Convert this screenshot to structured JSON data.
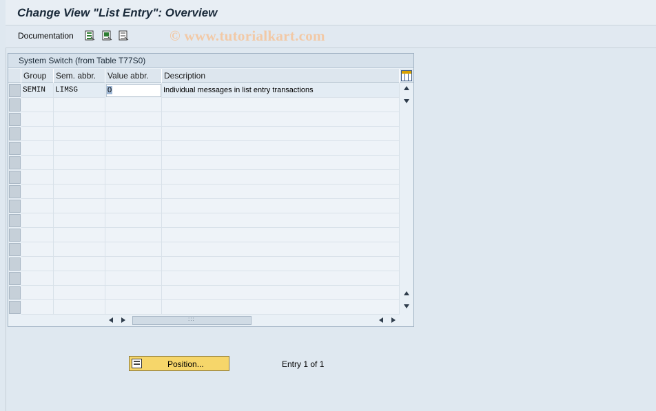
{
  "window": {
    "title": "Change View \"List Entry\": Overview"
  },
  "toolbar": {
    "documentation_label": "Documentation",
    "icons": [
      "select-all-icon",
      "select-block-icon",
      "deselect-all-icon"
    ],
    "watermark": "© www.tutorialkart.com"
  },
  "table": {
    "caption": "System Switch (from Table T77S0)",
    "columns": [
      "Group",
      "Sem. abbr.",
      "Value abbr.",
      "Description"
    ],
    "rows": [
      {
        "group": "SEMIN",
        "sem_abbr": "LIMSG",
        "value_abbr": "0",
        "description": "Individual messages in list entry transactions"
      }
    ]
  },
  "footer": {
    "position_button_label": "Position...",
    "entry_info": "Entry 1 of 1"
  },
  "colors": {
    "background": "#dfe8f0",
    "position_button": "#f6d66a",
    "watermark": "#f2c9a6"
  }
}
